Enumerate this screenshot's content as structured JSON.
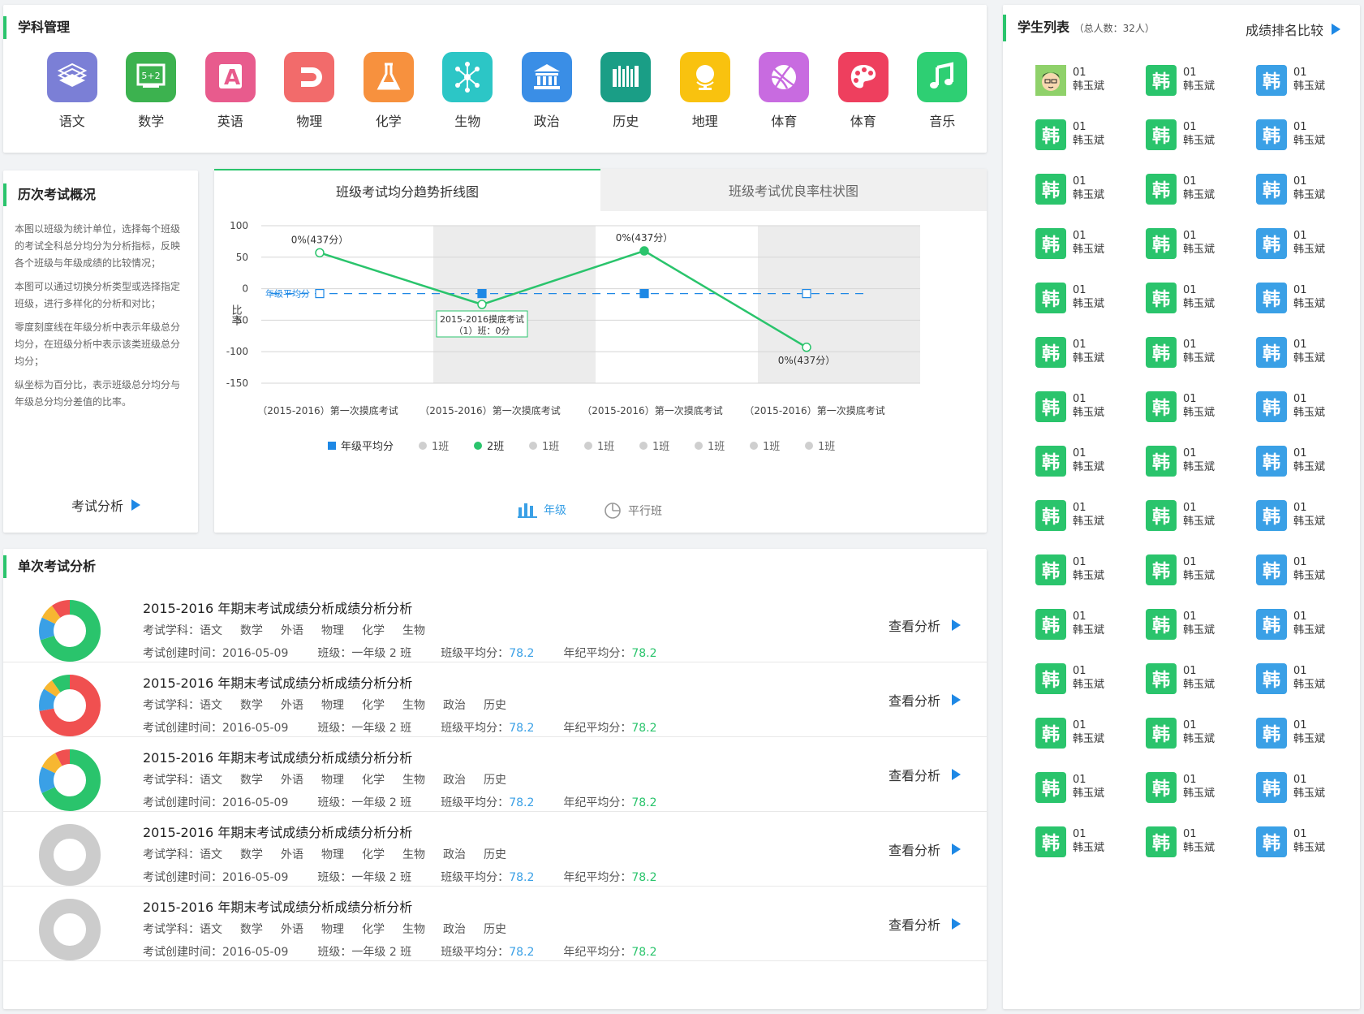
{
  "subjects": {
    "title": "学科管理",
    "items": [
      {
        "label": "语文",
        "color": "#7b7fd6",
        "icon": "books-icon"
      },
      {
        "label": "数学",
        "color": "#3cb24f",
        "icon": "chalkboard-icon"
      },
      {
        "label": "英语",
        "color": "#e85b8d",
        "icon": "letter-a-icon"
      },
      {
        "label": "物理",
        "color": "#f26b6b",
        "icon": "magnet-icon"
      },
      {
        "label": "化学",
        "color": "#f7913e",
        "icon": "flask-icon"
      },
      {
        "label": "生物",
        "color": "#2cc6c6",
        "icon": "molecule-icon"
      },
      {
        "label": "政治",
        "color": "#3a8ee6",
        "icon": "government-icon"
      },
      {
        "label": "历史",
        "color": "#1a9e86",
        "icon": "history-icon"
      },
      {
        "label": "地理",
        "color": "#f9c20f",
        "icon": "globe-icon"
      },
      {
        "label": "体育",
        "color": "#c86be0",
        "icon": "basketball-icon"
      },
      {
        "label": "体育",
        "color": "#ee3f5e",
        "icon": "palette-icon"
      },
      {
        "label": "音乐",
        "color": "#2ecf73",
        "icon": "music-note-icon"
      }
    ]
  },
  "history": {
    "title": "历次考试概况",
    "paragraphs": [
      "本图以班级为统计单位，选择每个班级的考试全科总分均分为分析指标，反映各个班级与年级成绩的比较情况；",
      "本图可以通过切换分析类型或选择指定班级，进行多样化的分析和对比；",
      "零度刻度线在年级分析中表示年级总分均分，在班级分析中表示该类班级总分均分；",
      "纵坐标为百分比，表示班级总分均分与年级总分均分差值的比率。"
    ],
    "link_label": "考试分析"
  },
  "chart_tabs": {
    "active": "班级考试均分趋势折线图",
    "inactive": "班级考试优良率柱状图"
  },
  "chart_data": {
    "type": "line",
    "ylabel": "比率",
    "ylim": [
      -150,
      100
    ],
    "yticks": [
      100,
      50,
      0,
      -50,
      -100,
      -150
    ],
    "categories": [
      "（2015-2016）第一次摸底考试",
      "（2015-2016）第一次摸底考试",
      "（2015-2016）第一次摸底考试",
      "（2015-2016）第一次摸底考试"
    ],
    "series": [
      {
        "name": "年级平均分",
        "values": [
          0,
          0,
          0,
          0
        ],
        "color": "#1e88e5",
        "style": "dashed"
      },
      {
        "name": "2班",
        "values": [
          57,
          -25,
          60,
          -93
        ],
        "color": "#2ac46c",
        "style": "solid"
      }
    ],
    "point_labels": [
      "0%(437分）",
      "0%(437分）",
      "0%(437分）",
      "0%(437分）"
    ],
    "baseline_label": "年级平均分",
    "tooltip": {
      "line1": "2015-2016摸底考试",
      "line2": "（1）班：0分"
    },
    "legend": [
      {
        "name": "年级平均分",
        "marker": "square",
        "color": "#1e88e5",
        "active": true
      },
      {
        "name": "1班",
        "marker": "circle",
        "color": "#cfcfcf",
        "active": false
      },
      {
        "name": "2班",
        "marker": "circle",
        "color": "#2ac46c",
        "active": true
      },
      {
        "name": "1班",
        "marker": "circle",
        "color": "#cfcfcf",
        "active": false
      },
      {
        "name": "1班",
        "marker": "circle",
        "color": "#cfcfcf",
        "active": false
      },
      {
        "name": "1班",
        "marker": "circle",
        "color": "#cfcfcf",
        "active": false
      },
      {
        "name": "1班",
        "marker": "circle",
        "color": "#cfcfcf",
        "active": false
      },
      {
        "name": "1班",
        "marker": "circle",
        "color": "#cfcfcf",
        "active": false
      },
      {
        "name": "1班",
        "marker": "circle",
        "color": "#cfcfcf",
        "active": false
      }
    ],
    "grid": true,
    "legend_position": "bottom"
  },
  "view_toggle": {
    "grade": "年级",
    "parallel": "平行班"
  },
  "single": {
    "title": "单次考试分析",
    "exams": [
      {
        "title": "2015-2016 年期末考试成绩分析成绩分析分析",
        "subjects_label": "考试学科：语文",
        "subjects": [
          "数学",
          "外语",
          "物理",
          "化学",
          "生物"
        ],
        "created": "考试创建时间：2016-05-09",
        "class": "班级：一年级 2 班",
        "class_avg_label": "班级平均分：",
        "class_avg": "78.2",
        "grade_avg_label": "年纪平均分：",
        "grade_avg": "78.2",
        "view": "查看分析",
        "donut": [
          {
            "v": 0.7,
            "c": "#2ac46c"
          },
          {
            "v": 0.12,
            "c": "#3aa0e6"
          },
          {
            "v": 0.08,
            "c": "#f7b731"
          },
          {
            "v": 0.1,
            "c": "#f05050"
          }
        ]
      },
      {
        "title": "2015-2016 年期末考试成绩分析成绩分析分析",
        "subjects_label": "考试学科：语文",
        "subjects": [
          "数学",
          "外语",
          "物理",
          "化学",
          "生物",
          "政治",
          "历史"
        ],
        "created": "考试创建时间：2016-05-09",
        "class": "班级：一年级 2 班",
        "class_avg_label": "班级平均分：",
        "class_avg": "78.2",
        "grade_avg_label": "年纪平均分：",
        "grade_avg": "78.2",
        "view": "查看分析",
        "donut": [
          {
            "v": 0.72,
            "c": "#f05050"
          },
          {
            "v": 0.12,
            "c": "#3aa0e6"
          },
          {
            "v": 0.06,
            "c": "#f7b731"
          },
          {
            "v": 0.1,
            "c": "#2ac46c"
          }
        ]
      },
      {
        "title": "2015-2016 年期末考试成绩分析成绩分析分析",
        "subjects_label": "考试学科：语文",
        "subjects": [
          "数学",
          "外语",
          "物理",
          "化学",
          "生物",
          "政治",
          "历史"
        ],
        "created": "考试创建时间：2016-05-09",
        "class": "班级：一年级 2 班",
        "class_avg_label": "班级平均分：",
        "class_avg": "78.2",
        "grade_avg_label": "年纪平均分：",
        "grade_avg": "78.2",
        "view": "查看分析",
        "donut": [
          {
            "v": 0.68,
            "c": "#2ac46c"
          },
          {
            "v": 0.14,
            "c": "#3aa0e6"
          },
          {
            "v": 0.1,
            "c": "#f7b731"
          },
          {
            "v": 0.08,
            "c": "#f05050"
          }
        ]
      },
      {
        "title": "2015-2016 年期末考试成绩分析成绩分析分析",
        "subjects_label": "考试学科：语文",
        "subjects": [
          "数学",
          "外语",
          "物理",
          "化学",
          "生物",
          "政治",
          "历史"
        ],
        "created": "考试创建时间：2016-05-09",
        "class": "班级：一年级 2 班",
        "class_avg_label": "班级平均分：",
        "class_avg": "78.2",
        "grade_avg_label": "年纪平均分：",
        "grade_avg": "78.2",
        "view": "查看分析",
        "donut": [
          {
            "v": 1,
            "c": "#cccccc"
          }
        ]
      },
      {
        "title": "2015-2016 年期末考试成绩分析成绩分析分析",
        "subjects_label": "考试学科：语文",
        "subjects": [
          "数学",
          "外语",
          "物理",
          "化学",
          "生物",
          "政治",
          "历史"
        ],
        "created": "考试创建时间：2016-05-09",
        "class": "班级：一年级 2 班",
        "class_avg_label": "班级平均分：",
        "class_avg": "78.2",
        "grade_avg_label": "年纪平均分：",
        "grade_avg": "78.2",
        "view": "查看分析",
        "donut": [
          {
            "v": 1,
            "c": "#cccccc"
          }
        ]
      }
    ]
  },
  "students": {
    "title": "学生列表",
    "count": "（总人数：32人）",
    "compare_link": "成绩排名比较",
    "avatar_char": "韩",
    "number": "01",
    "name": "韩玉斌",
    "col_colors": [
      "#2ac46c",
      "#2ac46c",
      "#3aa0e6"
    ],
    "rows": 15
  }
}
